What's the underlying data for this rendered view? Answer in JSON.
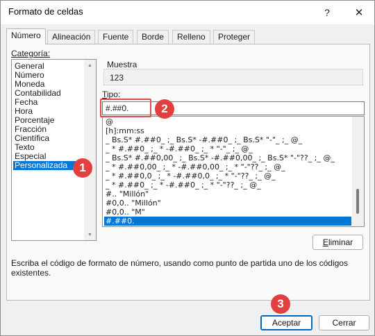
{
  "window": {
    "title": "Formato de celdas",
    "help": "?",
    "close": "✕"
  },
  "tabs": [
    {
      "label": "Número"
    },
    {
      "label": "Alineación"
    },
    {
      "label": "Fuente"
    },
    {
      "label": "Borde"
    },
    {
      "label": "Relleno"
    },
    {
      "label": "Proteger"
    }
  ],
  "categoria": {
    "label": "Categoría:",
    "items": [
      "General",
      "Número",
      "Moneda",
      "Contabilidad",
      "Fecha",
      "Hora",
      "Porcentaje",
      "Fracción",
      "Científica",
      "Texto",
      "Especial",
      "Personalizada"
    ],
    "selected": "Personalizada"
  },
  "muestra": {
    "label": "Muestra",
    "value": "123"
  },
  "tipo": {
    "label": "Tipo:",
    "value": "#.##0."
  },
  "formatos": {
    "items": [
      "@",
      "[h]:mm:ss",
      "_ Bs.S* #.##0_ ;_ Bs.S* -#.##0_ ;_ Bs.S* \"-\"_ ;_ @_",
      "_ * #.##0_ ;_ * -#.##0_ ;_ * \"-\"_ ;_ @_",
      "_ Bs.S* #.##0,00_ ;_ Bs.S* -#.##0,00_ ;_ Bs.S* \"-\"??_ ;_ @_",
      "_ * #.##0,00_ ;_ * -#.##0,00_ ;_ * \"-\"??_ ;_ @_",
      "_ * #.##0,0_ ;_ * -#.##0,0_ ;_ * \"-\"??_ ;_ @_",
      "_ * #.##0_ ;_ * -#.##0_ ;_ * \"-\"??_ ;_ @_",
      "#.. \"Millón\"",
      "#0,0.. \"Millón\"",
      "#0,0.. \"M\"",
      "#.##0."
    ],
    "selected": "#.##0."
  },
  "buttons": {
    "eliminar": "Eliminar",
    "aceptar": "Aceptar",
    "cerrar": "Cerrar"
  },
  "description": "Escriba el código de formato de número, usando como punto de partida uno de los códigos existentes.",
  "callouts": [
    "1",
    "2",
    "3"
  ],
  "colors": {
    "selection": "#0078d7",
    "callout": "#e2403f",
    "default_button_border": "#0067c0"
  }
}
